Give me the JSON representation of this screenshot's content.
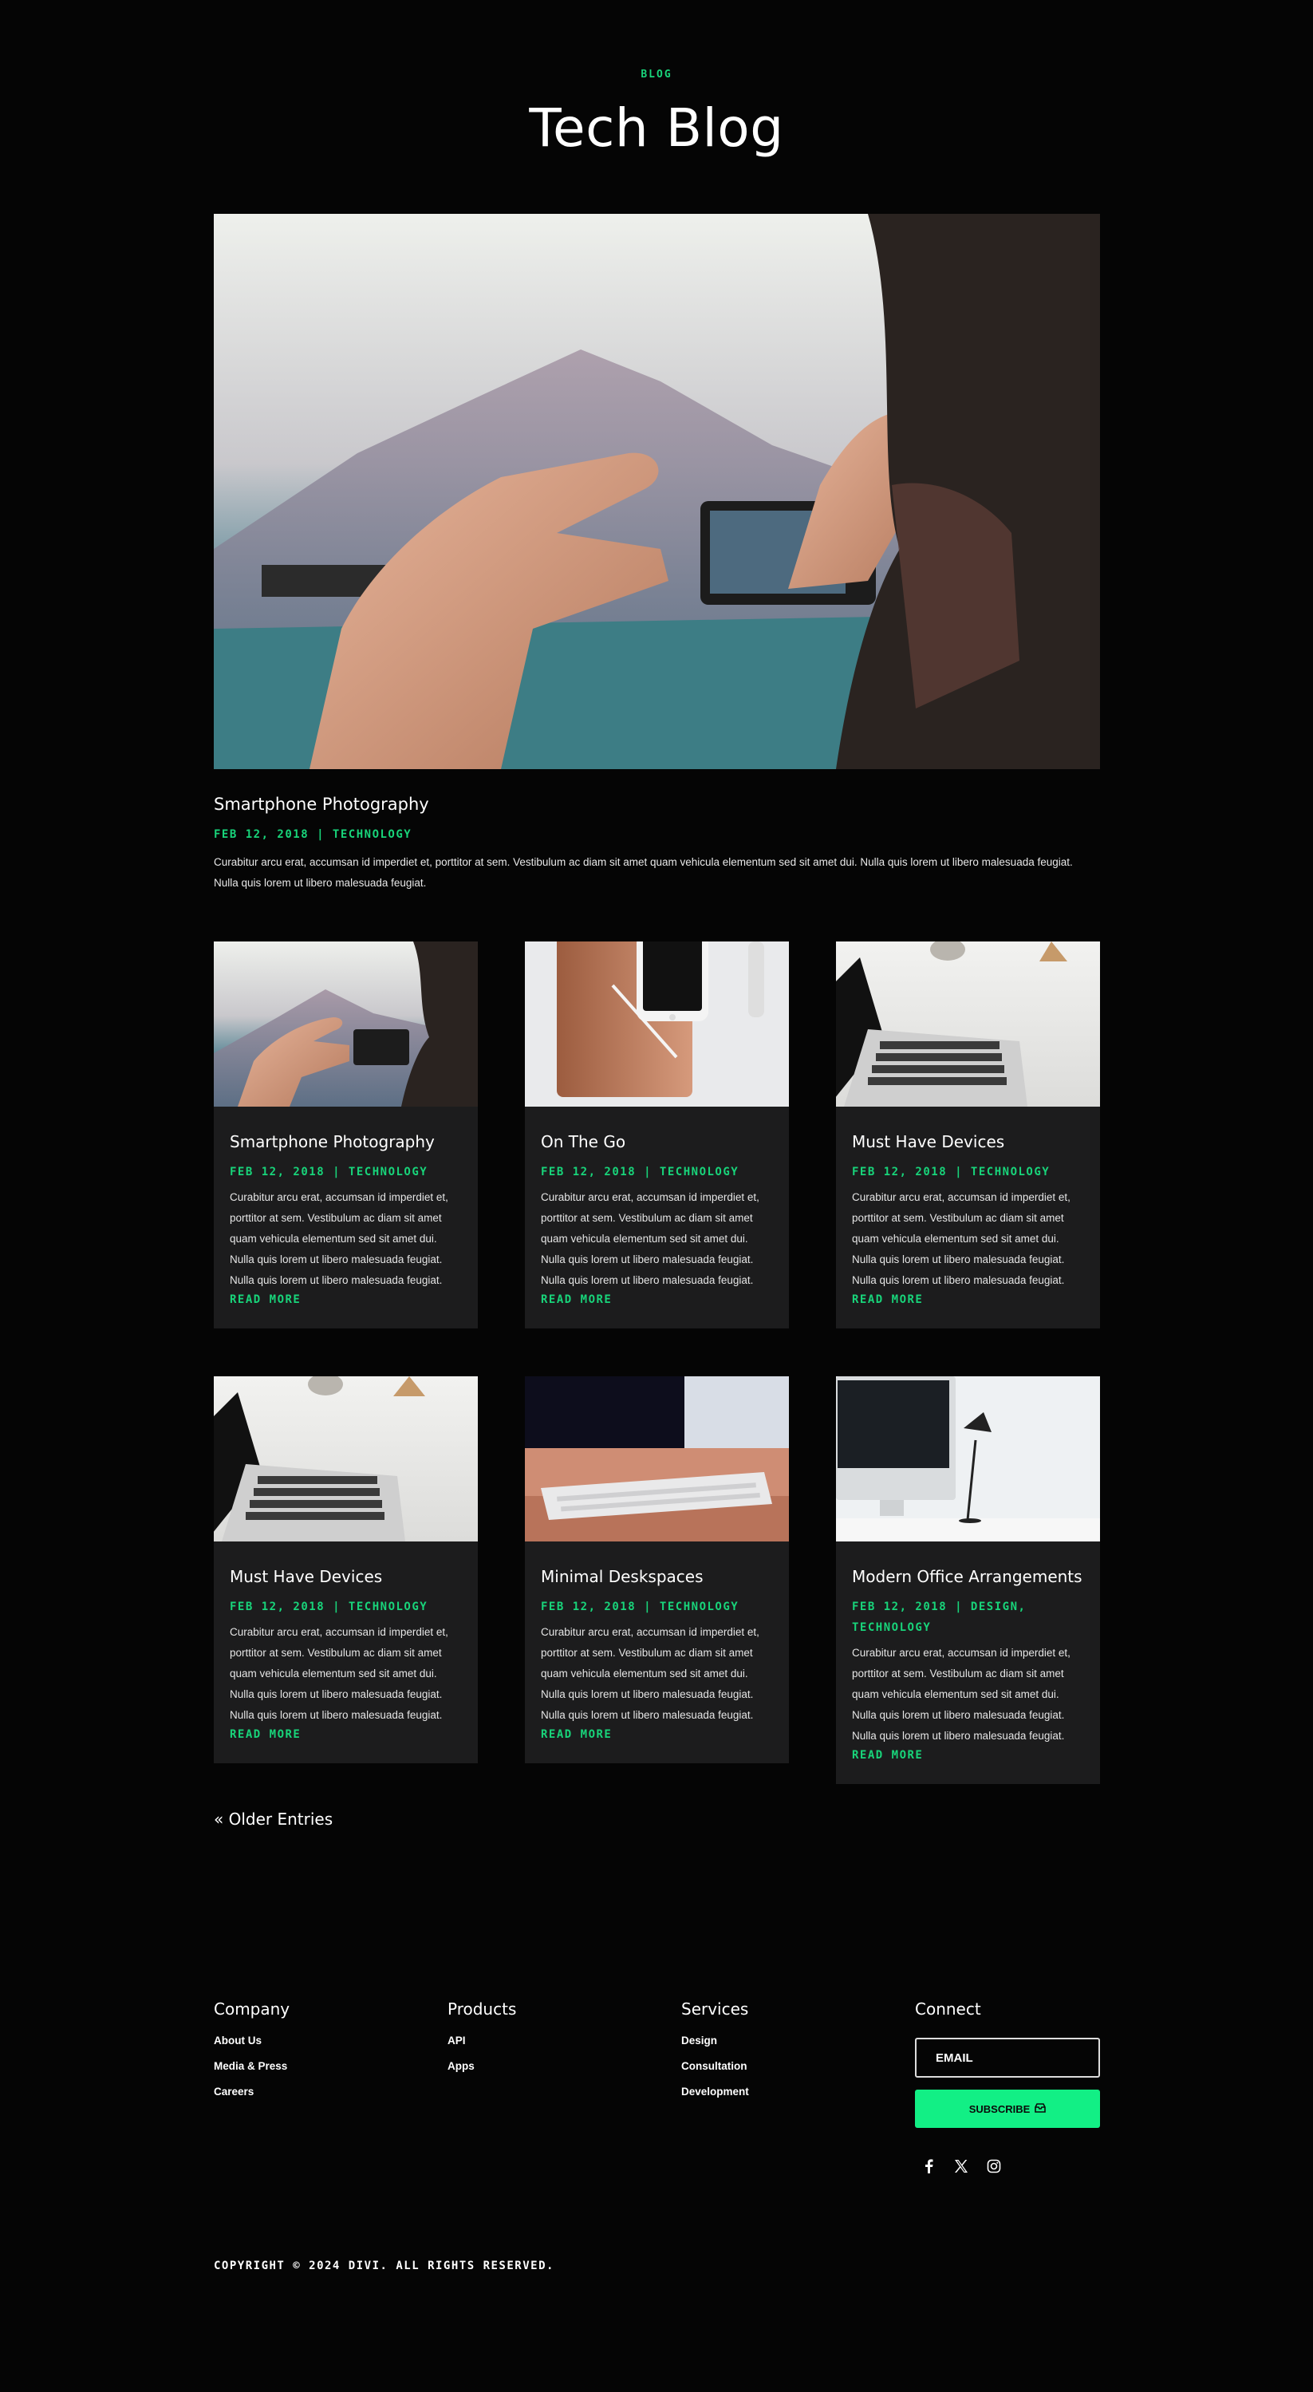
{
  "header": {
    "eyebrow": "BLOG",
    "title": "Tech Blog"
  },
  "featured": {
    "title": "Smartphone Photography",
    "meta": "FEB 12, 2018 | TECHNOLOGY",
    "excerpt": "Curabitur arcu erat, accumsan id imperdiet et, porttitor at sem. Vestibulum ac diam sit amet quam vehicula elementum sed sit amet dui. Nulla quis lorem ut libero malesuada feugiat. Nulla quis lorem ut libero malesuada feugiat."
  },
  "posts": [
    {
      "title": "Smartphone Photography",
      "meta": "FEB 12, 2018 | TECHNOLOGY",
      "excerpt": "Curabitur arcu erat, accumsan id imperdiet et, porttitor at sem. Vestibulum ac diam sit amet quam vehicula elementum sed sit amet dui. Nulla quis lorem ut libero malesuada feugiat. Nulla quis lorem ut libero malesuada feugiat.",
      "more": "READ MORE",
      "image": "phone-photo-image"
    },
    {
      "title": "On The Go",
      "meta": "FEB 12, 2018 | TECHNOLOGY",
      "excerpt": "Curabitur arcu erat, accumsan id imperdiet et, porttitor at sem. Vestibulum ac diam sit amet quam vehicula elementum sed sit amet dui. Nulla quis lorem ut libero malesuada feugiat. Nulla quis lorem ut libero malesuada feugiat.",
      "more": "READ MORE",
      "image": "tablet-phone-image"
    },
    {
      "title": "Must Have Devices",
      "meta": "FEB 12, 2018 | TECHNOLOGY",
      "excerpt": "Curabitur arcu erat, accumsan id imperdiet et, porttitor at sem. Vestibulum ac diam sit amet quam vehicula elementum sed sit amet dui. Nulla quis lorem ut libero malesuada feugiat. Nulla quis lorem ut libero malesuada feugiat.",
      "more": "READ MORE",
      "image": "laptop-image"
    },
    {
      "title": "Must Have Devices",
      "meta": "FEB 12, 2018 | TECHNOLOGY",
      "excerpt": "Curabitur arcu erat, accumsan id imperdiet et, porttitor at sem. Vestibulum ac diam sit amet quam vehicula elementum sed sit amet dui. Nulla quis lorem ut libero malesuada feugiat. Nulla quis lorem ut libero malesuada feugiat.",
      "more": "READ MORE",
      "image": "laptop-image"
    },
    {
      "title": "Minimal Deskspaces",
      "meta": "FEB 12, 2018 | TECHNOLOGY",
      "excerpt": "Curabitur arcu erat, accumsan id imperdiet et, porttitor at sem. Vestibulum ac diam sit amet quam vehicula elementum sed sit amet dui. Nulla quis lorem ut libero malesuada feugiat. Nulla quis lorem ut libero malesuada feugiat.",
      "more": "READ MORE",
      "image": "keyboard-image"
    },
    {
      "title": "Modern Office Arrangements",
      "meta": "FEB 12, 2018 | DESIGN, TECHNOLOGY",
      "excerpt": "Curabitur arcu erat, accumsan id imperdiet et, porttitor at sem. Vestibulum ac diam sit amet quam vehicula elementum sed sit amet dui. Nulla quis lorem ut libero malesuada feugiat. Nulla quis lorem ut libero malesuada feugiat.",
      "more": "READ MORE",
      "image": "imac-desk-image"
    }
  ],
  "pagination": {
    "older": "« Older Entries"
  },
  "footer": {
    "company": {
      "heading": "Company",
      "links": [
        "About Us",
        "Media & Press",
        "Careers"
      ]
    },
    "products": {
      "heading": "Products",
      "links": [
        "API",
        "Apps"
      ]
    },
    "services": {
      "heading": "Services",
      "links": [
        "Design",
        "Consultation",
        "Development"
      ]
    },
    "connect": {
      "heading": "Connect",
      "email_placeholder": "EMAIL",
      "subscribe_label": "SUBSCRIBE",
      "social": [
        "facebook-icon",
        "x-icon",
        "instagram-icon"
      ]
    },
    "copyright": "COPYRIGHT © 2024 DIVI. ALL RIGHTS RESERVED."
  },
  "colors": {
    "accent": "#18d47a",
    "button": "#12ef85",
    "background": "#050505",
    "card": "#1c1c1d"
  }
}
